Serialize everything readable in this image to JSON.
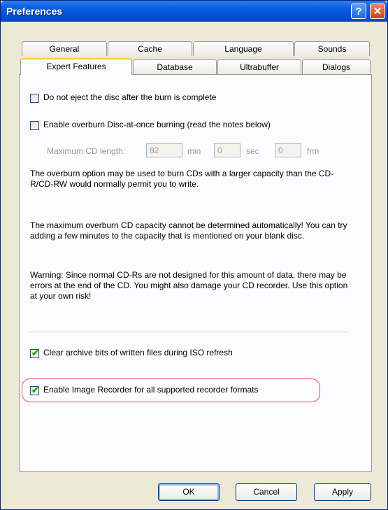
{
  "window": {
    "title": "Preferences"
  },
  "titlebar": {
    "help_glyph": "?",
    "close_glyph": "✕"
  },
  "tabs": {
    "row1": [
      "General",
      "Cache",
      "Language",
      "Sounds"
    ],
    "row2": [
      "Expert Features",
      "Database",
      "Ultrabuffer",
      "Dialogs"
    ],
    "active": "Expert Features"
  },
  "expert": {
    "no_eject_label": "Do not eject the disc after the burn is complete",
    "no_eject_checked": false,
    "overburn_label": "Enable overburn Disc-at-once burning (read the notes below)",
    "overburn_checked": false,
    "max_cd_label": "Maximum CD length:",
    "min_value": "82",
    "min_unit": "min",
    "sec_value": "0",
    "sec_unit": "sec",
    "frm_value": "0",
    "frm_unit": "frm",
    "note1": "The overburn option may be used to burn CDs with a larger capacity than the CD-R/CD-RW would normally permit you to write.",
    "note2": "The maximum overburn CD capacity cannot be determined automatically! You can try adding a few minutes to the capacity that is mentioned on your blank disc.",
    "warning": "Warning: Since normal CD-Rs are not designed for this amount of data, there may be errors at the end of the CD. You might also damage your CD recorder. Use this option at your own risk!",
    "clear_archive_label": "Clear archive bits of written files during ISO refresh",
    "clear_archive_checked": true,
    "image_recorder_label": "Enable Image Recorder for all supported recorder formats",
    "image_recorder_checked": true
  },
  "buttons": {
    "ok": "OK",
    "cancel": "Cancel",
    "apply": "Apply"
  },
  "colors": {
    "title_bar": "#0550d8",
    "highlight_ring": "#e0535b",
    "tab_accent": "#ffc83c"
  }
}
